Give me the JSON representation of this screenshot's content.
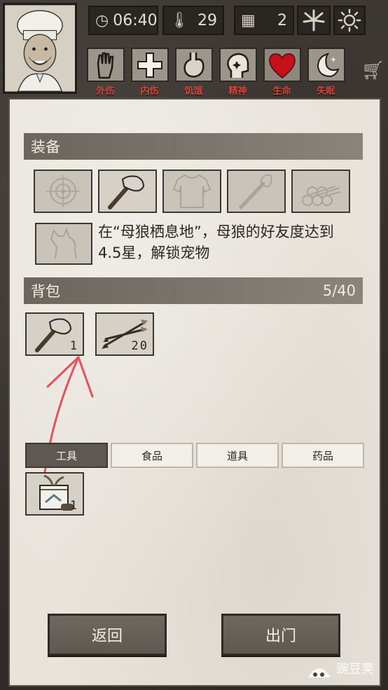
{
  "header": {
    "time": "06:40",
    "temperature": "29",
    "day": "2",
    "status_labels": [
      "外伤",
      "内伤",
      "饥饿",
      "精神",
      "生命",
      "失眠"
    ]
  },
  "equipment": {
    "title": "装备",
    "pet_text": "在“母狼栖息地”，母狼的好友度达到4.5星，解锁宠物"
  },
  "backpack": {
    "title": "背包",
    "capacity": "5/40",
    "items": [
      {
        "icon": "stone-axe-icon",
        "count": "1"
      },
      {
        "icon": "arrows-icon",
        "count": "20"
      }
    ]
  },
  "tabs": [
    "工具",
    "食品",
    "道具",
    "药品"
  ],
  "tab_items": [
    {
      "icon": "gift-box-icon",
      "count": "1"
    }
  ],
  "buttons": {
    "back": "返回",
    "exit": "出门"
  },
  "watermark": "豌豆荚",
  "colors": {
    "status_label": "#d9463b",
    "panel": "#e8e4dc",
    "section_bar": "#6b655d",
    "arrow": "#e8505b"
  }
}
